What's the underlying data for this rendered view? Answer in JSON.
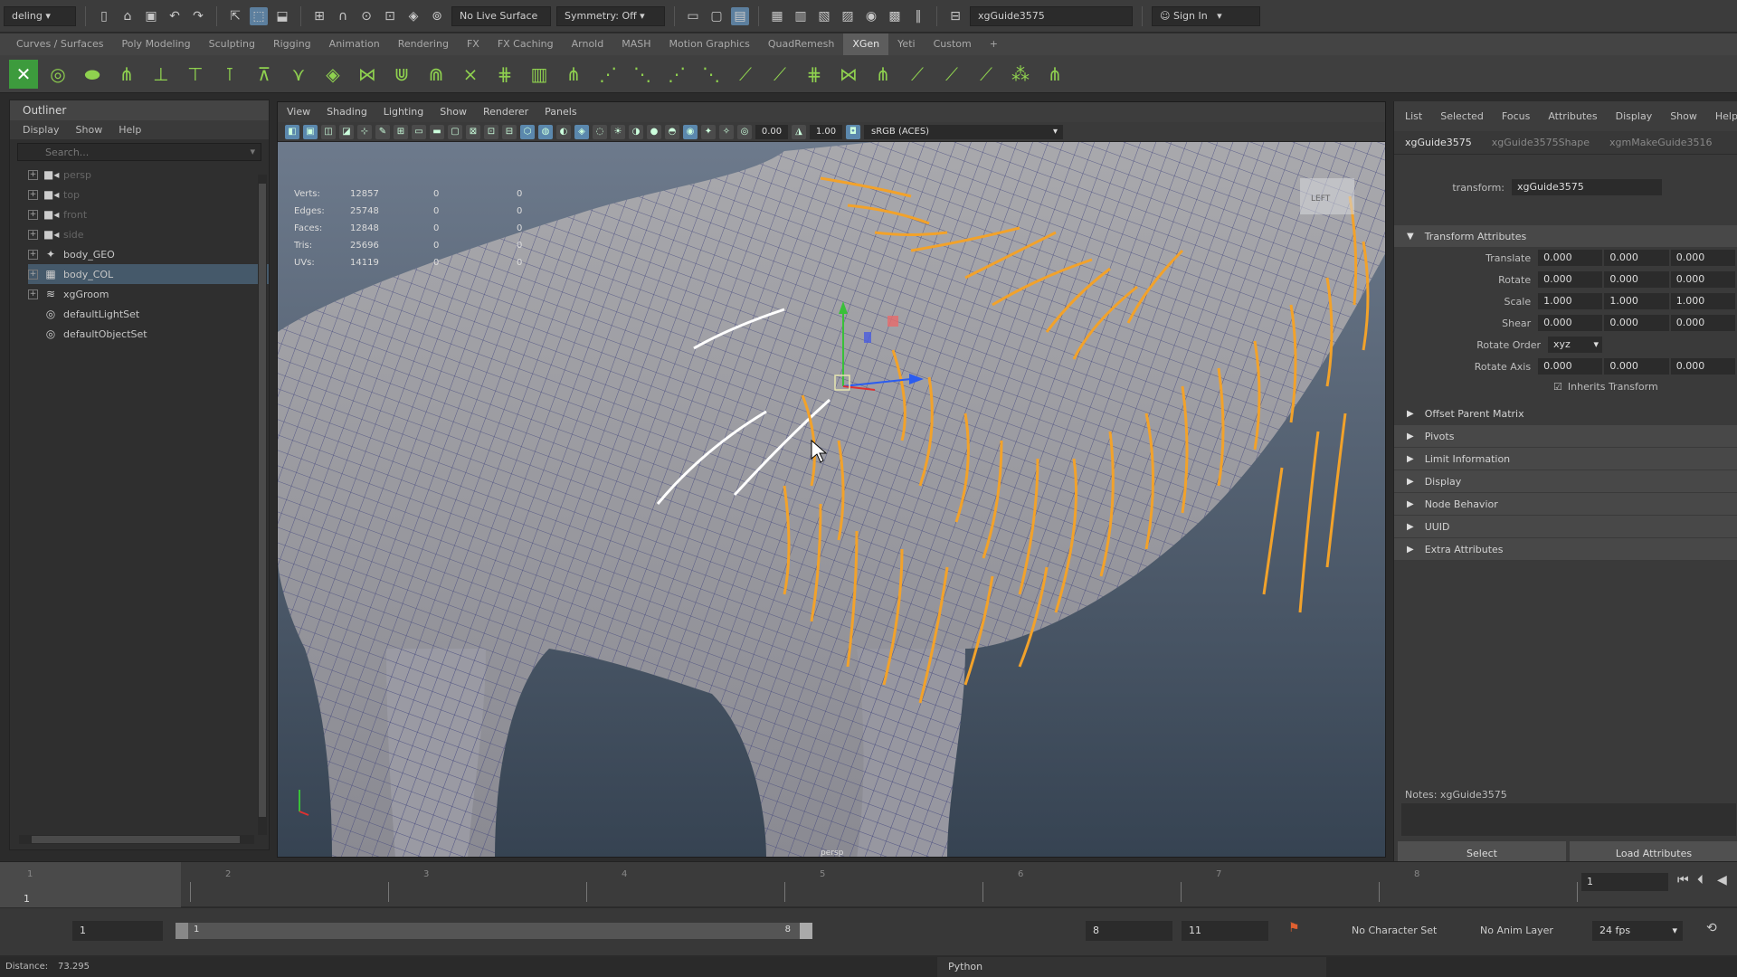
{
  "status_line": {
    "mode_menu": "deling",
    "live_surface": "No Live Surface",
    "symmetry": "Symmetry: Off",
    "name_field": "xgGuide3575",
    "sign_in": "Sign In"
  },
  "shelf_tabs": [
    "Curves / Surfaces",
    "Poly Modeling",
    "Sculpting",
    "Rigging",
    "Animation",
    "Rendering",
    "FX",
    "FX Caching",
    "Arnold",
    "MASH",
    "Motion Graphics",
    "QuadRemesh",
    "XGen",
    "Yeti",
    "Custom",
    "+"
  ],
  "shelf_active": "XGen",
  "outliner": {
    "title": "Outliner",
    "menu": [
      "Display",
      "Show",
      "Help"
    ],
    "search_placeholder": "Search...",
    "items": [
      {
        "label": "persp",
        "icon": "camera-icon",
        "dim": true
      },
      {
        "label": "top",
        "icon": "camera-icon",
        "dim": true
      },
      {
        "label": "front",
        "icon": "camera-icon",
        "dim": true
      },
      {
        "label": "side",
        "icon": "camera-icon",
        "dim": true
      },
      {
        "label": "body_GEO",
        "icon": "group-icon",
        "dim": false
      },
      {
        "label": "body_COL",
        "icon": "mesh-icon",
        "dim": false,
        "selected": true
      },
      {
        "label": "xgGroom",
        "icon": "xgen-icon",
        "dim": false
      },
      {
        "label": "defaultLightSet",
        "icon": "set-icon",
        "dim": false
      },
      {
        "label": "defaultObjectSet",
        "icon": "set-icon",
        "dim": false
      }
    ]
  },
  "viewport": {
    "menu": [
      "View",
      "Shading",
      "Lighting",
      "Show",
      "Renderer",
      "Panels"
    ],
    "field_a": "0.00",
    "field_b": "1.00",
    "color_space": "sRGB (ACES)",
    "camera_label": "persp",
    "hud": [
      {
        "label": "Verts:",
        "v1": "12857",
        "v2": "0",
        "v3": "0"
      },
      {
        "label": "Edges:",
        "v1": "25748",
        "v2": "0",
        "v3": "0"
      },
      {
        "label": "Faces:",
        "v1": "12848",
        "v2": "0",
        "v3": "0"
      },
      {
        "label": "Tris:",
        "v1": "25696",
        "v2": "0",
        "v3": "0"
      },
      {
        "label": "UVs:",
        "v1": "14119",
        "v2": "0",
        "v3": "0"
      }
    ],
    "view_cube": "LEFT"
  },
  "attr_editor": {
    "menu": [
      "List",
      "Selected",
      "Focus",
      "Attributes",
      "Display",
      "Show",
      "Help"
    ],
    "tabs": [
      "xgGuide3575",
      "xgGuide3575Shape",
      "xgmMakeGuide3516"
    ],
    "transform_label": "transform:",
    "transform_value": "xgGuide3575",
    "section_title": "Transform Attributes",
    "rows": [
      {
        "label": "Translate",
        "x": "0.000",
        "y": "0.000",
        "z": "0.000"
      },
      {
        "label": "Rotate",
        "x": "0.000",
        "y": "0.000",
        "z": "0.000"
      },
      {
        "label": "Scale",
        "x": "1.000",
        "y": "1.000",
        "z": "1.000"
      },
      {
        "label": "Shear",
        "x": "0.000",
        "y": "0.000",
        "z": "0.000"
      }
    ],
    "rotate_order_label": "Rotate Order",
    "rotate_order_value": "xyz",
    "rotate_axis_label": "Rotate Axis",
    "rotate_axis": {
      "x": "0.000",
      "y": "0.000",
      "z": "0.000"
    },
    "inherits_label": "Inherits Transform",
    "sections": [
      "Offset Parent Matrix",
      "Pivots",
      "Limit Information",
      "Display",
      "Node Behavior",
      "UUID",
      "Extra Attributes"
    ],
    "notes": "Notes: xgGuide3575",
    "buttons": [
      "Select",
      "Load Attributes"
    ]
  },
  "timeline": {
    "ticks": [
      "1",
      "2",
      "3",
      "4",
      "5",
      "6",
      "7",
      "8"
    ],
    "current_frame_left": "1",
    "current_frame_field": "1"
  },
  "range": {
    "start": "1",
    "range_start": "1",
    "range_end": "8",
    "end_a": "8",
    "end_b": "11",
    "character_set": "No Character Set",
    "anim_layer": "No Anim Layer",
    "fps": "24 fps"
  },
  "command_line": {
    "distance_label": "Distance:",
    "distance_value": "73.295",
    "python_label": "Python"
  }
}
